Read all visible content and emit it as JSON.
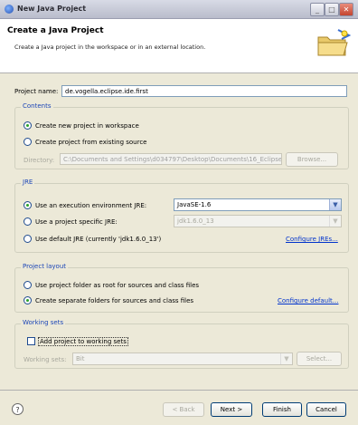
{
  "window": {
    "title": "New Java Project"
  },
  "banner": {
    "title": "Create a Java Project",
    "description": "Create a Java project in the workspace or in an external location."
  },
  "project": {
    "name_label": "Project name:",
    "name_value": "de.vogella.eclipse.ide.first"
  },
  "contents": {
    "title": "Contents",
    "option_new": "Create new project in workspace",
    "option_existing": "Create project from existing source",
    "directory_label": "Directory:",
    "directory_value": "C:\\Documents and Settings\\d034797\\Desktop\\Documents\\16_Eclipse",
    "browse_label": "Browse..."
  },
  "jre": {
    "title": "JRE",
    "option_execution_env": "Use an execution environment JRE:",
    "execution_env_value": "JavaSE-1.6",
    "option_project_specific": "Use a project specific JRE:",
    "project_specific_value": "jdk1.6.0_13",
    "option_default": "Use default JRE (currently 'jdk1.6.0_13')",
    "configure_link": "Configure JREs..."
  },
  "layout": {
    "title": "Project layout",
    "option_root": "Use project folder as root for sources and class files",
    "option_separate": "Create separate folders for sources and class files",
    "configure_link": "Configure default..."
  },
  "working_sets": {
    "title": "Working sets",
    "add_label": "Add project to working sets",
    "sets_label": "Working sets:",
    "sets_value": "Bit",
    "select_label": "Select..."
  },
  "buttons": {
    "help": "?",
    "back": "< Back",
    "next": "Next >",
    "finish": "Finish",
    "cancel": "Cancel"
  }
}
